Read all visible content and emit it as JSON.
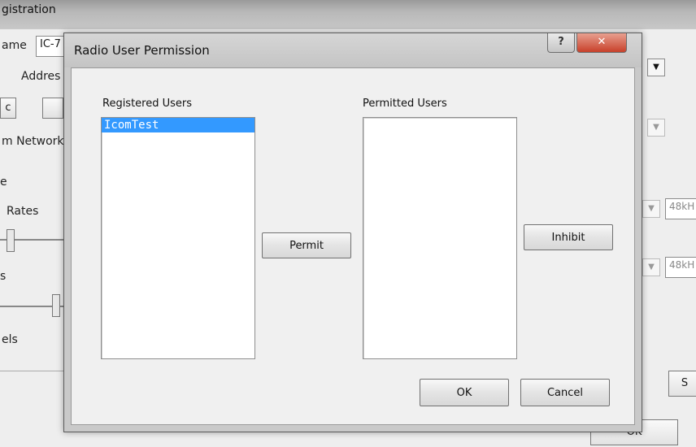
{
  "background_window": {
    "title": "gistration",
    "labels": {
      "name": "ame",
      "name_value": "IC-7",
      "address": "Addres",
      "c_fragment": "c",
      "network": "m Network",
      "e_fragment": "e",
      "rates": "Rates",
      "s_fragment": "s",
      "els": "els",
      "rate_value_1": "48kH",
      "rate_value_2": "48kH",
      "s_button": "S",
      "ok_button": "OK"
    }
  },
  "dialog": {
    "title": "Radio User Permission",
    "help_label": "?",
    "close_label": "✕",
    "registered": {
      "label": "Registered Users",
      "items": [
        "IcomTest"
      ],
      "selected_index": 0
    },
    "permitted": {
      "label": "Permitted Users",
      "items": []
    },
    "buttons": {
      "permit": "Permit",
      "inhibit": "Inhibit",
      "ok": "OK",
      "cancel": "Cancel"
    }
  },
  "icons": {
    "dropdown": "chevron-down-icon",
    "close": "close-icon",
    "help": "help-icon"
  },
  "colors": {
    "selection": "#3399ff",
    "close_button": "#c8402a"
  }
}
